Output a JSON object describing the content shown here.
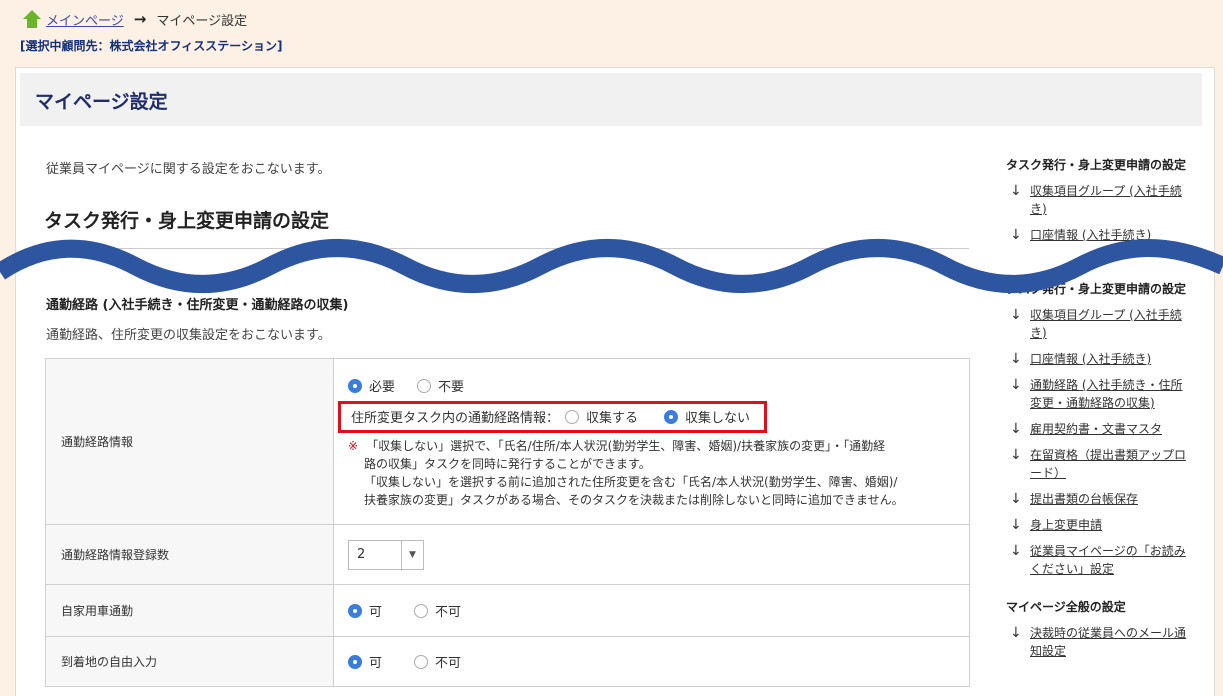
{
  "breadcrumb": {
    "home_label": "メインページ",
    "current": "マイページ設定"
  },
  "client_label": "[選択中顧問先：株式会社オフィスステーション]",
  "page_title": "マイページ設定",
  "intro": "従業員マイページに関する設定をおこないます。",
  "section_heading": "タスク発行・身上変更申請の設定",
  "subsection": {
    "heading": "通勤経路 (入社手続き・住所変更・通勤経路の収集)",
    "description": "通勤経路、住所変更の収集設定をおこないます。"
  },
  "rows": [
    {
      "label": "通勤経路情報",
      "options": [
        "必要",
        "不要"
      ],
      "selected": "必要",
      "sub_setting": {
        "label": "住所変更タスク内の通勤経路情報：",
        "options": [
          "収集する",
          "収集しない"
        ],
        "selected": "収集しない"
      },
      "note_mark": "※",
      "note_lines": [
        "「収集しない」選択で、「氏名/住所/本人状況(勤労学生、障害、婚姻)/扶養家族の変更」・「通勤経",
        "路の収集」タスクを同時に発行することができます。",
        "「収集しない」を選択する前に追加された住所変更を含む「氏名/本人状況(勤労学生、障害、婚姻)/",
        "扶養家族の変更」タスクがある場合、そのタスクを決裁または削除しないと同時に追加できません。"
      ]
    },
    {
      "label": "通勤経路情報登録数",
      "select_value": "2"
    },
    {
      "label": "自家用車通勤",
      "options": [
        "可",
        "不可"
      ],
      "selected": "可"
    },
    {
      "label": "到着地の自由入力",
      "options": [
        "可",
        "不可"
      ],
      "selected": "可"
    }
  ],
  "sidebar_top": {
    "heading": "タスク発行・身上変更申請の設定",
    "items": [
      "収集項目グループ (入社手続き)",
      "口座情報 (入社手続き)"
    ]
  },
  "sidebar": {
    "heading": "タスク発行・身上変更申請の設定",
    "items": [
      "収集項目グループ (入社手続き)",
      "口座情報 (入社手続き)",
      "通勤経路 (入社手続き・住所変更・通勤経路の収集)",
      "雇用契約書・文書マスタ",
      "在留資格（提出書類アップロード）",
      "提出書類の台帳保存",
      "身上変更申請",
      "従業員マイページの「お読みください」設定"
    ],
    "heading2": "マイページ全般の設定",
    "items2": [
      "決裁時の従業員へのメール通知設定"
    ]
  },
  "colors": {
    "accent": "#3b7ddd",
    "highlight": "#e10f1a",
    "wave": "#2e56a0",
    "link": "#3b49a3"
  }
}
